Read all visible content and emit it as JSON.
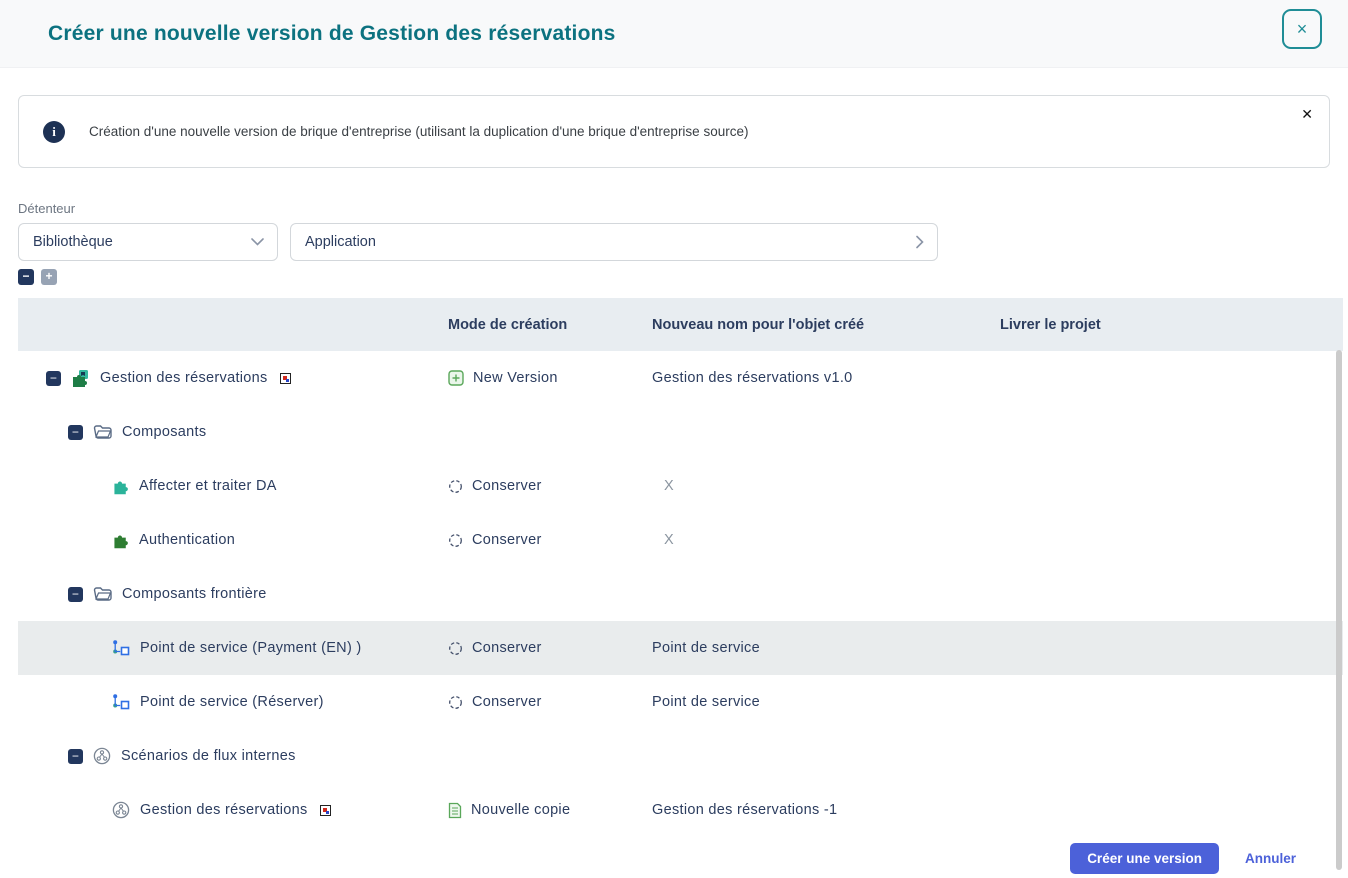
{
  "header": {
    "title": "Créer une nouvelle version de Gestion des réservations",
    "close_label": "×"
  },
  "banner": {
    "text": "Création d'une nouvelle version de brique d'entreprise (utilisant la duplication d'une brique d'entreprise source)",
    "close_label": "✕"
  },
  "owner": {
    "label": "Détenteur",
    "type_value": "Bibliothèque",
    "target_value": "Application"
  },
  "tree_controls": {
    "collapse_all": "−",
    "expand_all": "+"
  },
  "glyphs": {
    "expander_minus": "−"
  },
  "table": {
    "columns": [
      "",
      "Mode de création",
      "Nouveau nom pour l'objet créé",
      "Livrer le projet"
    ],
    "rows": [
      {
        "label": "Gestion des réservations",
        "level": 0,
        "icon": "application-icon",
        "badge": true,
        "mode": "New Version",
        "mode_icon": "new-version-icon",
        "new_name": "Gestion des réservations v1.0"
      },
      {
        "label": "Composants",
        "level": 1,
        "icon": "folder-icon"
      },
      {
        "label": "Affecter et traiter DA",
        "level": 2,
        "icon": "component-icon-teal",
        "mode": "Conserver",
        "mode_icon": "keep-icon",
        "new_name": "X"
      },
      {
        "label": "Authentication",
        "level": 2,
        "icon": "component-icon-green",
        "mode": "Conserver",
        "mode_icon": "keep-icon",
        "new_name": "X"
      },
      {
        "label": "Composants frontière",
        "level": 1,
        "icon": "folder-icon"
      },
      {
        "label": "Point de service (Payment (EN) )",
        "level": 2,
        "icon": "service-point-icon",
        "mode": "Conserver",
        "mode_icon": "keep-icon",
        "new_name": "Point de service",
        "highlighted": true
      },
      {
        "label": "Point de service (Réserver)",
        "level": 2,
        "icon": "service-point-icon",
        "mode": "Conserver",
        "mode_icon": "keep-icon",
        "new_name": "Point de service"
      },
      {
        "label": "Scénarios de flux internes",
        "level": 1,
        "icon": "scenario-icon"
      },
      {
        "label": "Gestion des réservations",
        "level": 2,
        "icon": "scenario-icon",
        "badge": true,
        "mode": "Nouvelle copie",
        "mode_icon": "copy-icon",
        "new_name": "Gestion des réservations -1"
      }
    ]
  },
  "footer": {
    "create_label": "Créer une version",
    "cancel_label": "Annuler"
  },
  "colors": {
    "accent_teal": "#0c7280",
    "navy": "#22375e",
    "primary_button": "#4c61d9",
    "table_header_bg": "#e8edf1",
    "highlight_row": "#e9eced",
    "component_teal": "#2bb39a",
    "component_green": "#2e7d32",
    "service_blue": "#2f6fe4",
    "create_green": "#5aa75a"
  }
}
